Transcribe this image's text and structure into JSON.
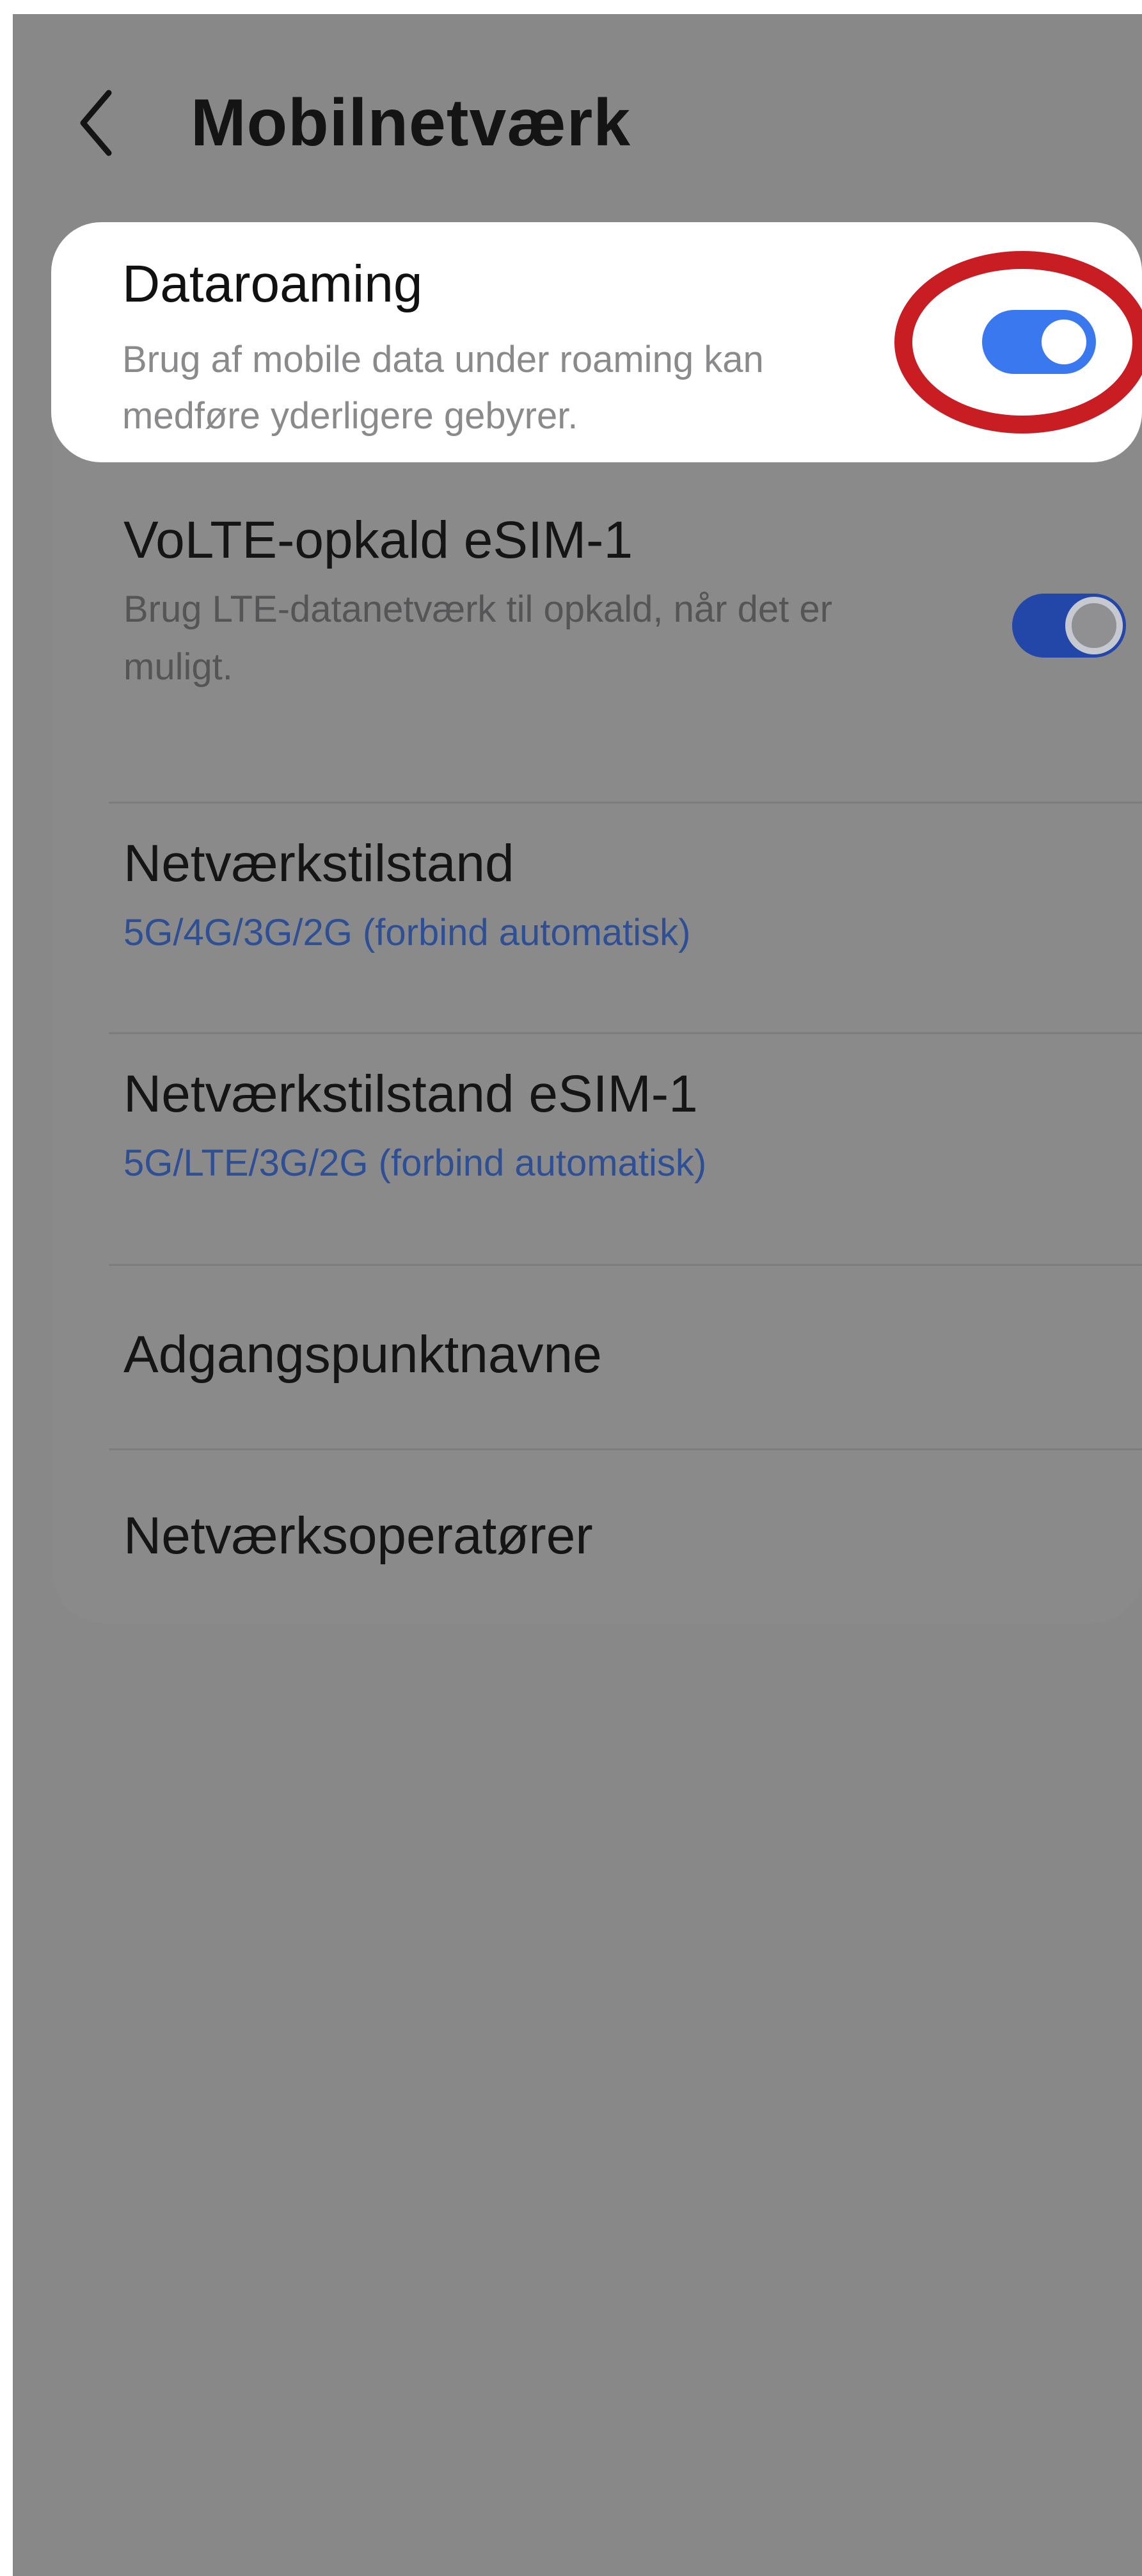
{
  "header": {
    "title": "Mobilnetværk",
    "back_icon": "chevron-left-icon"
  },
  "settings": {
    "data_roaming": {
      "title": "Dataroaming",
      "subtitle_line1": "Brug af mobile data under roaming kan",
      "subtitle_line2": "medføre yderligere gebyrer.",
      "enabled": true
    },
    "volte": {
      "title": "VoLTE-opkald eSIM-1",
      "subtitle_line1": "Brug LTE-datanetværk til opkald, når det er",
      "subtitle_line2": "muligt.",
      "enabled": true
    },
    "network_mode": {
      "title": "Netværkstilstand",
      "value": "5G/4G/3G/2G (forbind automatisk)"
    },
    "network_mode_esim": {
      "title": "Netværkstilstand eSIM-1",
      "value": "5G/LTE/3G/2G (forbind automatisk)"
    },
    "apn": {
      "title": "Adgangspunktnavne"
    },
    "operators": {
      "title": "Netværksoperatører"
    }
  },
  "colors": {
    "toggle_on": "#3a78f0",
    "annotation": "#c81d22",
    "link_blue": "#2f4f95"
  }
}
